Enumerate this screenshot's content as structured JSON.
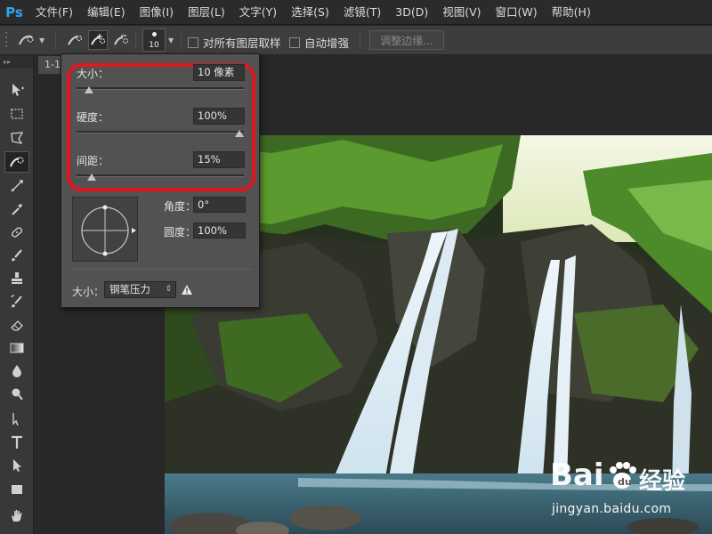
{
  "app": {
    "logo": "Ps"
  },
  "menu": [
    "文件(F)",
    "编辑(E)",
    "图像(I)",
    "图层(L)",
    "文字(Y)",
    "选择(S)",
    "滤镜(T)",
    "3D(D)",
    "视图(V)",
    "窗口(W)",
    "帮助(H)"
  ],
  "options": {
    "brush_size": "10",
    "sample_all_layers_label": "对所有图层取样",
    "auto_enhance_label": "自动增强",
    "refine_edge_label": "调整边缘..."
  },
  "document": {
    "tab_label": "1-1"
  },
  "brush_popup": {
    "size_label": "大小：",
    "size_value": "10 像素",
    "size_slider": 0.05,
    "hardness_label": "硬度：",
    "hardness_value": "100%",
    "hardness_slider": 1.0,
    "spacing_label": "间距：",
    "spacing_value": "15%",
    "spacing_slider": 0.07,
    "angle_label": "角度：",
    "angle_value": "0°",
    "roundness_label": "圆度：",
    "roundness_value": "100%",
    "pressure_label": "大小：",
    "pressure_option": "钢笔压力"
  },
  "watermark": {
    "brand_left": "Bai",
    "brand_right": "经验",
    "url": "jingyan.baidu.com"
  },
  "colors": {
    "highlight": "#e4161d",
    "ps_blue": "#2fa3f6"
  }
}
